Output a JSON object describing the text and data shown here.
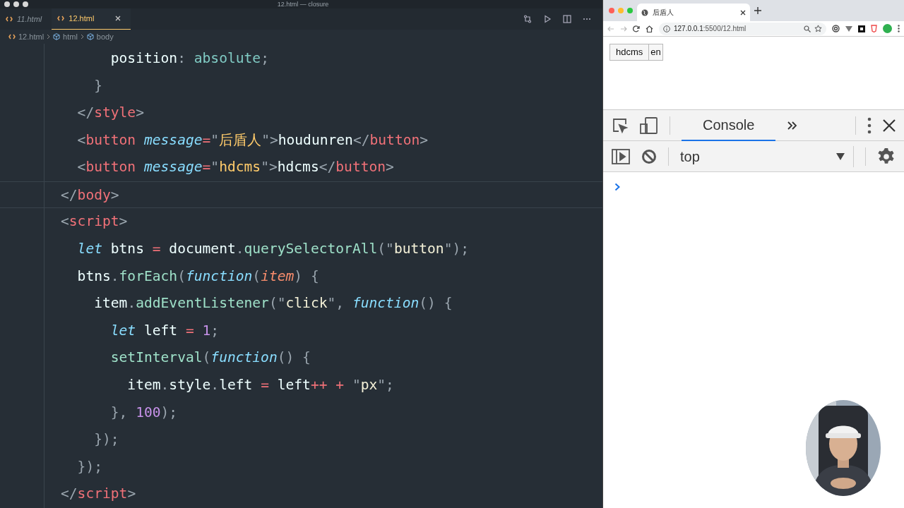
{
  "editor": {
    "window_title": "12.html — closure",
    "tabs": [
      {
        "label": "11.html",
        "selected": false,
        "preview": true
      },
      {
        "label": "12.html",
        "selected": true,
        "preview": false
      }
    ],
    "breadcrumb": [
      "12.html",
      "html",
      "body"
    ],
    "code_lines": [
      {
        "current": false,
        "tokens": [
          {
            "kind": "plain",
            "text": "      position"
          },
          {
            "kind": "punct",
            "text": ": "
          },
          {
            "kind": "value",
            "text": "absolute"
          },
          {
            "kind": "punct",
            "text": ";"
          }
        ]
      },
      {
        "current": false,
        "tokens": [
          {
            "kind": "punct",
            "text": "    }"
          }
        ]
      },
      {
        "current": false,
        "tokens": [
          {
            "kind": "punct",
            "text": "  </"
          },
          {
            "kind": "tag",
            "text": "style"
          },
          {
            "kind": "punct",
            "text": ">"
          }
        ]
      },
      {
        "current": false,
        "tokens": [
          {
            "kind": "punct",
            "text": "  <"
          },
          {
            "kind": "tag",
            "text": "button"
          },
          {
            "kind": "attr",
            "text": " message"
          },
          {
            "kind": "op",
            "text": "="
          },
          {
            "kind": "punct",
            "text": "\""
          },
          {
            "kind": "attr-value",
            "text": "后盾人"
          },
          {
            "kind": "punct",
            "text": "\">"
          },
          {
            "kind": "plain",
            "text": "houdunren"
          },
          {
            "kind": "punct",
            "text": "</"
          },
          {
            "kind": "tag",
            "text": "button"
          },
          {
            "kind": "punct",
            "text": ">"
          }
        ]
      },
      {
        "current": false,
        "tokens": [
          {
            "kind": "punct",
            "text": "  <"
          },
          {
            "kind": "tag",
            "text": "button"
          },
          {
            "kind": "attr",
            "text": " message"
          },
          {
            "kind": "op",
            "text": "="
          },
          {
            "kind": "punct",
            "text": "\""
          },
          {
            "kind": "attr-value",
            "text": "hdcms"
          },
          {
            "kind": "punct",
            "text": "\">"
          },
          {
            "kind": "plain",
            "text": "hdcms"
          },
          {
            "kind": "punct",
            "text": "</"
          },
          {
            "kind": "tag",
            "text": "button"
          },
          {
            "kind": "punct",
            "text": ">"
          }
        ]
      },
      {
        "current": true,
        "tokens": [
          {
            "kind": "punct",
            "text": "</"
          },
          {
            "kind": "tag",
            "text": "body"
          },
          {
            "kind": "punct",
            "text": ">"
          }
        ]
      },
      {
        "current": false,
        "tokens": [
          {
            "kind": "punct",
            "text": "<"
          },
          {
            "kind": "tag",
            "text": "script"
          },
          {
            "kind": "punct",
            "text": ">"
          }
        ]
      },
      {
        "current": false,
        "tokens": [
          {
            "kind": "keyword",
            "text": "  let"
          },
          {
            "kind": "plain",
            "text": " btns "
          },
          {
            "kind": "op",
            "text": "="
          },
          {
            "kind": "plain",
            "text": " document"
          },
          {
            "kind": "punct",
            "text": "."
          },
          {
            "kind": "method",
            "text": "querySelectorAll"
          },
          {
            "kind": "punct",
            "text": "(\""
          },
          {
            "kind": "string",
            "text": "button"
          },
          {
            "kind": "punct",
            "text": "\");"
          }
        ]
      },
      {
        "current": false,
        "tokens": [
          {
            "kind": "plain",
            "text": "  btns"
          },
          {
            "kind": "punct",
            "text": "."
          },
          {
            "kind": "method",
            "text": "forEach"
          },
          {
            "kind": "punct",
            "text": "("
          },
          {
            "kind": "keyword",
            "text": "function"
          },
          {
            "kind": "punct",
            "text": "("
          },
          {
            "kind": "param",
            "text": "item"
          },
          {
            "kind": "punct",
            "text": ") {"
          }
        ]
      },
      {
        "current": false,
        "tokens": [
          {
            "kind": "plain",
            "text": "    item"
          },
          {
            "kind": "punct",
            "text": "."
          },
          {
            "kind": "method",
            "text": "addEventListener"
          },
          {
            "kind": "punct",
            "text": "(\""
          },
          {
            "kind": "string",
            "text": "click"
          },
          {
            "kind": "punct",
            "text": "\", "
          },
          {
            "kind": "keyword",
            "text": "function"
          },
          {
            "kind": "punct",
            "text": "() {"
          }
        ]
      },
      {
        "current": false,
        "tokens": [
          {
            "kind": "keyword",
            "text": "      let"
          },
          {
            "kind": "plain",
            "text": " left "
          },
          {
            "kind": "op",
            "text": "= "
          },
          {
            "kind": "number",
            "text": "1"
          },
          {
            "kind": "punct",
            "text": ";"
          }
        ]
      },
      {
        "current": false,
        "tokens": [
          {
            "kind": "method",
            "text": "      setInterval"
          },
          {
            "kind": "punct",
            "text": "("
          },
          {
            "kind": "keyword",
            "text": "function"
          },
          {
            "kind": "punct",
            "text": "() {"
          }
        ]
      },
      {
        "current": false,
        "tokens": [
          {
            "kind": "plain",
            "text": "        item"
          },
          {
            "kind": "punct",
            "text": "."
          },
          {
            "kind": "plain",
            "text": "style"
          },
          {
            "kind": "punct",
            "text": "."
          },
          {
            "kind": "plain",
            "text": "left "
          },
          {
            "kind": "op",
            "text": "="
          },
          {
            "kind": "plain",
            "text": " left"
          },
          {
            "kind": "op",
            "text": "++ +"
          },
          {
            "kind": "punct",
            "text": " \""
          },
          {
            "kind": "string",
            "text": "px"
          },
          {
            "kind": "punct",
            "text": "\";"
          }
        ]
      },
      {
        "current": false,
        "tokens": [
          {
            "kind": "punct",
            "text": "      }, "
          },
          {
            "kind": "number",
            "text": "100"
          },
          {
            "kind": "punct",
            "text": ");"
          }
        ]
      },
      {
        "current": false,
        "tokens": [
          {
            "kind": "punct",
            "text": "    });"
          }
        ]
      },
      {
        "current": false,
        "tokens": [
          {
            "kind": "punct",
            "text": "  });"
          }
        ]
      },
      {
        "current": false,
        "tokens": [
          {
            "kind": "punct",
            "text": "</"
          },
          {
            "kind": "tag",
            "text": "script"
          },
          {
            "kind": "punct",
            "text": ">"
          }
        ]
      }
    ]
  },
  "browser": {
    "tab_title": "后盾人",
    "address": {
      "host": "127.0.0.1",
      "path": ":5500/12.html"
    },
    "page_buttons": [
      "hdcms",
      "en"
    ],
    "devtools": {
      "tabs": [
        {
          "label": "Console",
          "selected": true
        }
      ],
      "context": "top"
    }
  }
}
